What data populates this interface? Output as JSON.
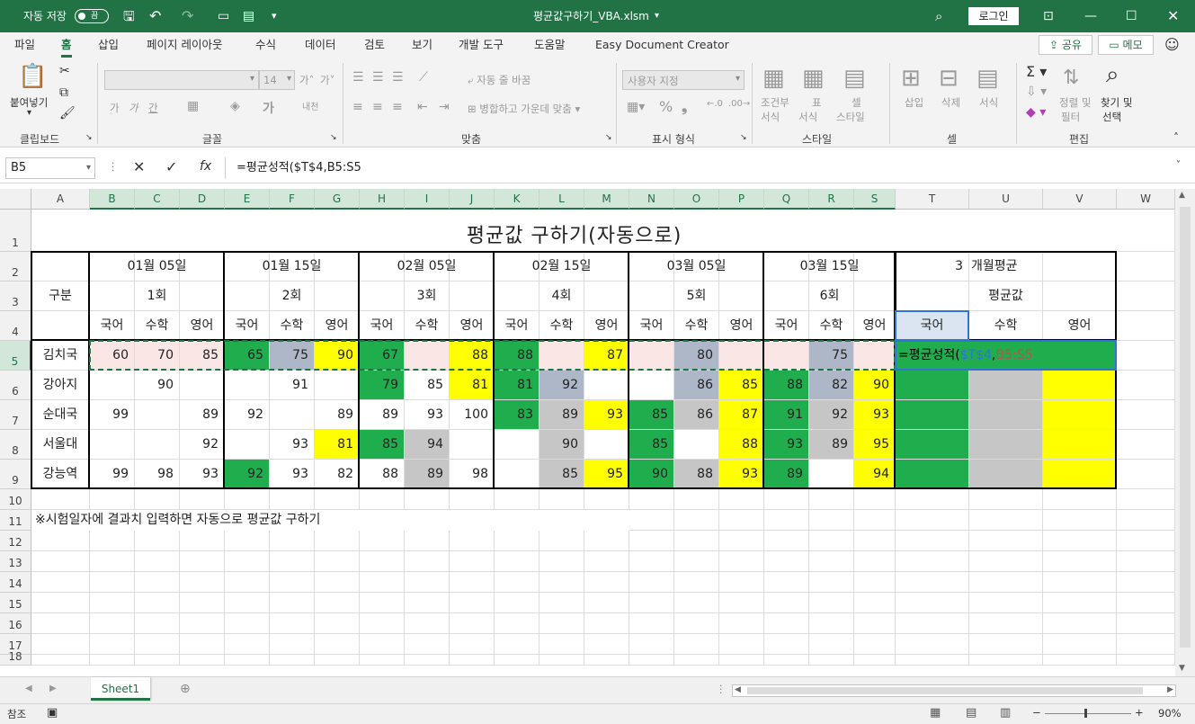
{
  "titlebar": {
    "autosave_label": "자동 저장",
    "autosave_state": "끔",
    "filename": "평균값구하기_VBA.xlsm",
    "login": "로그인"
  },
  "menu": {
    "items": [
      "파일",
      "홈",
      "삽입",
      "페이지 레이아웃",
      "수식",
      "데이터",
      "검토",
      "보기",
      "개발 도구",
      "도움말",
      "Easy Document Creator"
    ],
    "active": "홈",
    "share": "공유",
    "memo": "메모"
  },
  "ribbon": {
    "clipboard": {
      "paste": "붙여넣기",
      "label": "클립보드"
    },
    "font": {
      "size": "14",
      "label": "글꼴",
      "bold": "가",
      "italic": "가",
      "underline": "간"
    },
    "align": {
      "wrap": "자동 줄 바꿈",
      "merge": "병합하고 가운데 맞춤",
      "label": "맞춤"
    },
    "number": {
      "format": "사용자 지정",
      "label": "표시 형식"
    },
    "style": {
      "cond": "조건부",
      "cond2": "서식",
      "table": "표",
      "table2": "서식",
      "cell": "셀",
      "cell2": "스타일",
      "label": "스타일"
    },
    "cells": {
      "insert": "삽입",
      "delete": "삭제",
      "format": "서식",
      "label": "셀"
    },
    "edit": {
      "sort": "정렬 및",
      "sort2": "필터",
      "find": "찾기 및",
      "find2": "선택",
      "label": "편집"
    }
  },
  "formula": {
    "namebox": "B5",
    "content": "=평균성적($T$4,B5:S5"
  },
  "columns": [
    "A",
    "B",
    "C",
    "D",
    "E",
    "F",
    "G",
    "H",
    "I",
    "J",
    "K",
    "L",
    "M",
    "N",
    "O",
    "P",
    "Q",
    "R",
    "S",
    "T",
    "U",
    "V",
    "W"
  ],
  "rows": [
    "1",
    "2",
    "3",
    "4",
    "5",
    "6",
    "7",
    "8",
    "9",
    "10",
    "11",
    "12",
    "13",
    "14",
    "15",
    "16",
    "17",
    "18"
  ],
  "sheet": {
    "title": "평균값 구하기(자동으로)",
    "category": "구분",
    "dates": [
      "01월  05일",
      "01월  15일",
      "02월  05일",
      "02월  15일",
      "03월  05일",
      "03월  15일"
    ],
    "rounds": [
      "1회",
      "2회",
      "3회",
      "4회",
      "5회",
      "6회"
    ],
    "subjects": [
      "국어",
      "수학",
      "영어"
    ],
    "period_num": "3",
    "period_label": "개월평균",
    "avg_label": "평균값",
    "names": [
      "김치국",
      "강아지",
      "순대국",
      "서울대",
      "강능역"
    ],
    "note": "※시험일자에 결과치 입력하면 자동으로 평균값 구하기",
    "edit_formula": "=평균성적(",
    "edit_ref1": "$T$4",
    "edit_comma": ",",
    "edit_ref2": "B5:S5",
    "scores": [
      [
        "60",
        "70",
        "85",
        "65",
        "75",
        "90",
        "67",
        "",
        "88",
        "88",
        "",
        "87",
        "",
        "80",
        "",
        "",
        "75",
        ""
      ],
      [
        "",
        "90",
        "",
        "",
        "91",
        "",
        "79",
        "85",
        "81",
        "81",
        "92",
        "",
        "",
        "86",
        "85",
        "88",
        "82",
        "90"
      ],
      [
        "99",
        "",
        "89",
        "92",
        "",
        "89",
        "89",
        "93",
        "100",
        "83",
        "89",
        "93",
        "85",
        "86",
        "87",
        "91",
        "92",
        "93"
      ],
      [
        "",
        "",
        "92",
        "",
        "93",
        "81",
        "85",
        "94",
        "",
        "",
        "90",
        "",
        "85",
        "",
        "88",
        "93",
        "89",
        "95"
      ],
      [
        "99",
        "98",
        "93",
        "92",
        "93",
        "82",
        "88",
        "89",
        "98",
        "",
        "85",
        "95",
        "90",
        "88",
        "93",
        "89",
        "",
        "94"
      ]
    ]
  },
  "sheet_tab": "Sheet1",
  "status": {
    "mode": "참조",
    "zoom": "90%"
  },
  "colors": {
    "green": "#1fad4e",
    "yellow": "#ffff00",
    "gray": "#c6c6c6",
    "pink": "#fbe6e6",
    "bluegray": "#aeb7c8",
    "excel": "#217346"
  }
}
